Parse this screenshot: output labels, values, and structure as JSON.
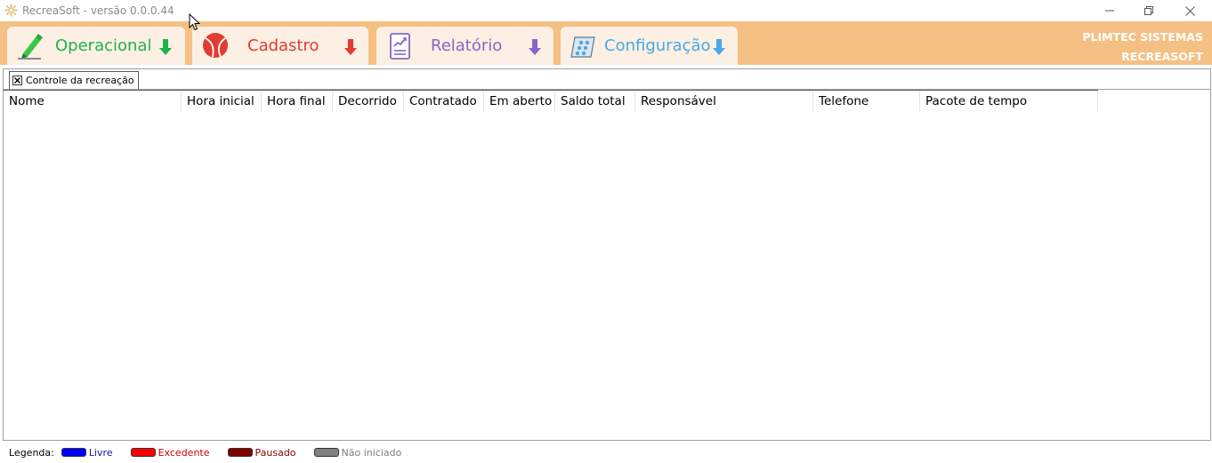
{
  "window": {
    "title": "RecreaSoft  -  versão 0.0.0.44",
    "controls": [
      "minimize",
      "restore",
      "close"
    ]
  },
  "ribbon": {
    "tabs": [
      {
        "label": "Operacional",
        "icon": "highlighter-icon",
        "color": "#22b14c"
      },
      {
        "label": "Cadastro",
        "icon": "ball-icon",
        "color": "#e03c31"
      },
      {
        "label": "Relatório",
        "icon": "report-chart-icon",
        "color": "#8a64c8"
      },
      {
        "label": "Configuração",
        "icon": "settings-panel-icon",
        "color": "#4aa8e8"
      }
    ],
    "brand_line1": "PLIMTEC SISTEMAS",
    "brand_line2": "RECREASOFT",
    "background": "#f5c084"
  },
  "document_tab": {
    "label": "Controle da recreação"
  },
  "grid": {
    "columns": [
      "Nome",
      "Hora inicial",
      "Hora final",
      "Decorrido",
      "Contratado",
      "Em aberto",
      "Saldo total",
      "Responsável",
      "Telefone",
      "Pacote de tempo"
    ],
    "rows": []
  },
  "legend": {
    "label": "Legenda:",
    "items": [
      {
        "label": "Livre",
        "color": "#0000ff",
        "text_color": "#1a1aa0"
      },
      {
        "label": "Excedente",
        "color": "#ff0000",
        "text_color": "#cc0000"
      },
      {
        "label": "Pausado",
        "color": "#800000",
        "text_color": "#800000"
      },
      {
        "label": "Não iniciado",
        "color": "#808080",
        "text_color": "#808080"
      }
    ]
  }
}
